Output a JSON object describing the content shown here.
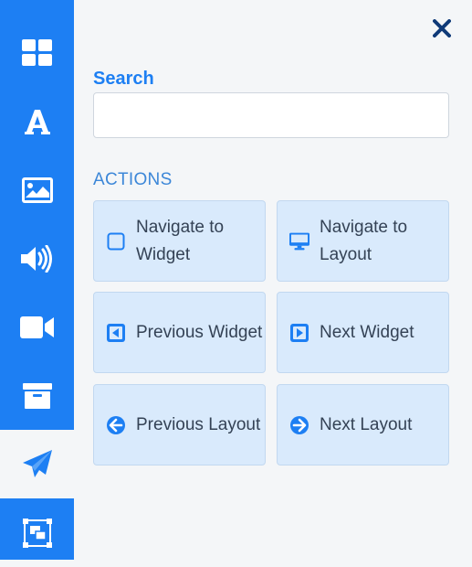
{
  "search": {
    "label": "Search",
    "value": "",
    "placeholder": ""
  },
  "actions": {
    "heading": "ACTIONS",
    "items": [
      {
        "label": "Navigate to Widget",
        "icon": "square-outline-icon"
      },
      {
        "label": "Navigate to Layout",
        "icon": "monitor-icon"
      },
      {
        "label": "Previous Widget",
        "icon": "caret-square-left-icon"
      },
      {
        "label": "Next Widget",
        "icon": "caret-square-right-icon"
      },
      {
        "label": "Previous Layout",
        "icon": "arrow-circle-left-icon"
      },
      {
        "label": "Next Layout",
        "icon": "arrow-circle-right-icon"
      }
    ]
  },
  "sidebar": {
    "items": [
      {
        "icon": "grid-icon"
      },
      {
        "icon": "font-icon"
      },
      {
        "icon": "image-icon"
      },
      {
        "icon": "volume-icon"
      },
      {
        "icon": "video-icon"
      },
      {
        "icon": "archive-icon"
      },
      {
        "icon": "paper-plane-icon",
        "active": true
      },
      {
        "icon": "object-group-icon"
      }
    ]
  },
  "colors": {
    "primary": "#1d7ff3",
    "panel": "#f4f6f8",
    "card": "#d9eafc",
    "close": "#0f3a78"
  }
}
